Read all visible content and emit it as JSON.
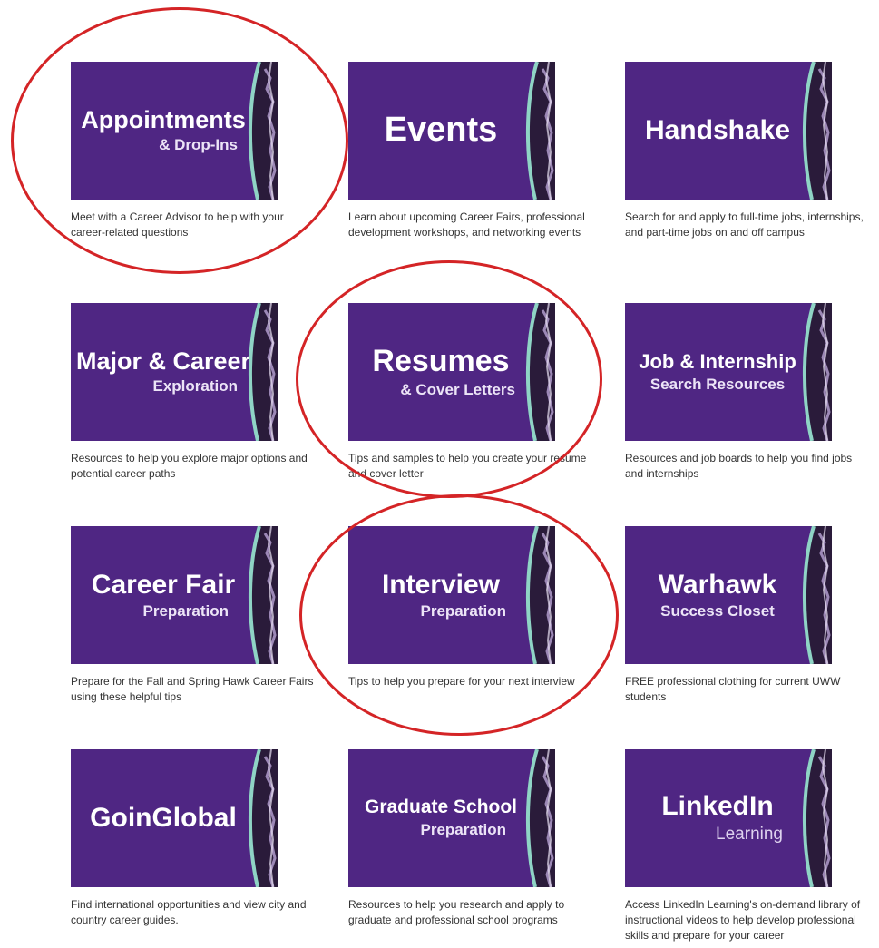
{
  "tiles": [
    {
      "title": "Appointments",
      "subtitle": "& Drop-Ins",
      "description": "Meet with a Career Advisor to help with your career-related questions"
    },
    {
      "title": "Events",
      "subtitle": "",
      "description": "Learn about upcoming Career Fairs, professional development workshops, and networking events"
    },
    {
      "title": "Handshake",
      "subtitle": "",
      "description": "Search for and apply to full-time jobs, internships, and part-time jobs on and off campus"
    },
    {
      "title": "Major & Career",
      "subtitle": "Exploration",
      "description": "Resources to help you explore major options and potential career paths"
    },
    {
      "title": "Resumes",
      "subtitle": "& Cover Letters",
      "description": "Tips and samples to help you create your resume and cover letter"
    },
    {
      "title": "Job & Internship",
      "subtitle": "Search Resources",
      "description": "Resources and job boards to help you find jobs and internships"
    },
    {
      "title": "Career Fair",
      "subtitle": "Preparation",
      "description": "Prepare for the Fall and Spring Hawk Career Fairs using these helpful tips"
    },
    {
      "title": "Interview",
      "subtitle": "Preparation",
      "description": "Tips to help you prepare for your next interview"
    },
    {
      "title": "Warhawk",
      "subtitle": "Success Closet",
      "description": "FREE professional clothing for current UWW students"
    },
    {
      "title": "GoinGlobal",
      "subtitle": "",
      "description": "Find international opportunities and view city and country career guides."
    },
    {
      "title": "Graduate School",
      "subtitle": "Preparation",
      "description": "Resources to help you research and apply to graduate and professional school programs"
    },
    {
      "title": "LinkedIn",
      "subtitle": "Learning",
      "description": "Access LinkedIn Learning's on-demand library of instructional videos to help develop professional skills and prepare for your career"
    }
  ],
  "colors": {
    "tile_background": "#4f2683",
    "accent_stripe": "#8fd4c5",
    "annotation_circle": "#d42426"
  },
  "highlighted_tiles": [
    "Appointments",
    "Resumes",
    "Interview"
  ]
}
